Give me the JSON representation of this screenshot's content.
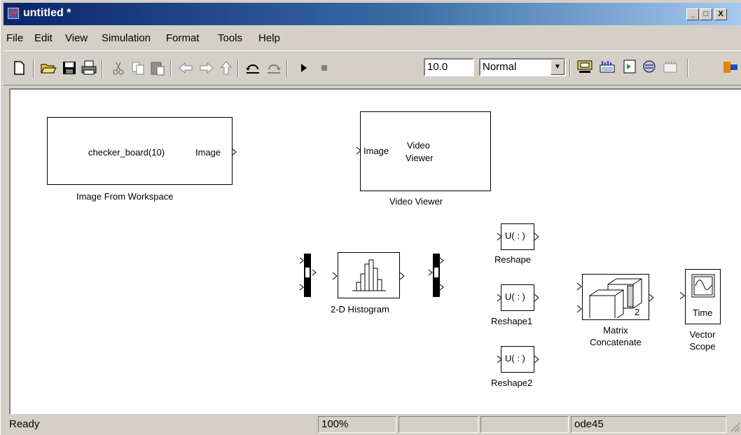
{
  "window": {
    "title": "untitled *",
    "minimize": "_",
    "maximize": "□",
    "close": "X"
  },
  "menu": [
    "File",
    "Edit",
    "View",
    "Simulation",
    "Format",
    "Tools",
    "Help"
  ],
  "toolbar": {
    "stop_time": "10.0",
    "sim_mode": "Normal"
  },
  "blocks": {
    "image_from_ws": {
      "content": "checker_board(10)",
      "port": "Image",
      "label": "Image From Workspace"
    },
    "video_viewer": {
      "port": "Image",
      "title_line1": "Video",
      "title_line2": "Viewer",
      "label": "Video Viewer"
    },
    "histogram": {
      "label": "2-D Histogram"
    },
    "reshape": {
      "content": "U( : )",
      "label": "Reshape"
    },
    "reshape1": {
      "content": "U( : )",
      "label": "Reshape1"
    },
    "reshape2": {
      "content": "U( : )",
      "label": "Reshape2"
    },
    "matrix_concat": {
      "num": "2",
      "label_line1": "Matrix",
      "label_line2": "Concatenate"
    },
    "vector_scope": {
      "inner": "Time",
      "label_line1": "Vector",
      "label_line2": "Scope"
    }
  },
  "status": {
    "text": "Ready",
    "zoom": "100%",
    "solver": "ode45"
  }
}
